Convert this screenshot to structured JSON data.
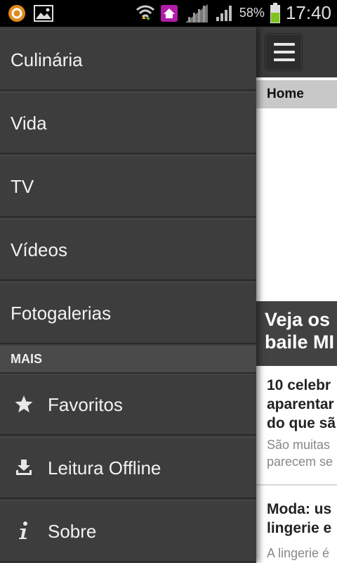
{
  "status_bar": {
    "battery_percent": "58%",
    "time": "17:40",
    "icons": [
      "ring-notification-icon",
      "image-notification-icon",
      "wifi-icon",
      "home-app-icon",
      "signal-icon",
      "signal-icon-2",
      "battery-icon"
    ]
  },
  "drawer": {
    "items": [
      {
        "label": "Culinária"
      },
      {
        "label": "Vida"
      },
      {
        "label": "TV"
      },
      {
        "label": "Vídeos"
      },
      {
        "label": "Fotogalerias"
      }
    ],
    "section_label": "MAIS",
    "more_items": [
      {
        "label": "Favoritos",
        "icon": "star-icon"
      },
      {
        "label": "Leitura Offline",
        "icon": "download-icon"
      },
      {
        "label": "Sobre",
        "icon": "info-icon"
      }
    ]
  },
  "main": {
    "breadcrumb": "Home",
    "hero_title_line1": "Veja os",
    "hero_title_line2": "baile MI",
    "articles": [
      {
        "title_line1": "10 celebr",
        "title_line2": "aparentar",
        "title_line3": "do que sã",
        "summary_line1": "São muitas",
        "summary_line2": "parecem se"
      },
      {
        "title_line1": "Moda: us",
        "title_line2": "lingerie e",
        "summary_line1": "A lingerie é"
      }
    ]
  },
  "colors": {
    "drawer_bg": "#3d3d3d",
    "section_bg": "#4a4a4a",
    "appbar_bg": "#3a3a3a",
    "breadcrumb_bg": "#c8c8c8",
    "hero_title_bg": "#424242",
    "battery": "#7fc41a"
  }
}
